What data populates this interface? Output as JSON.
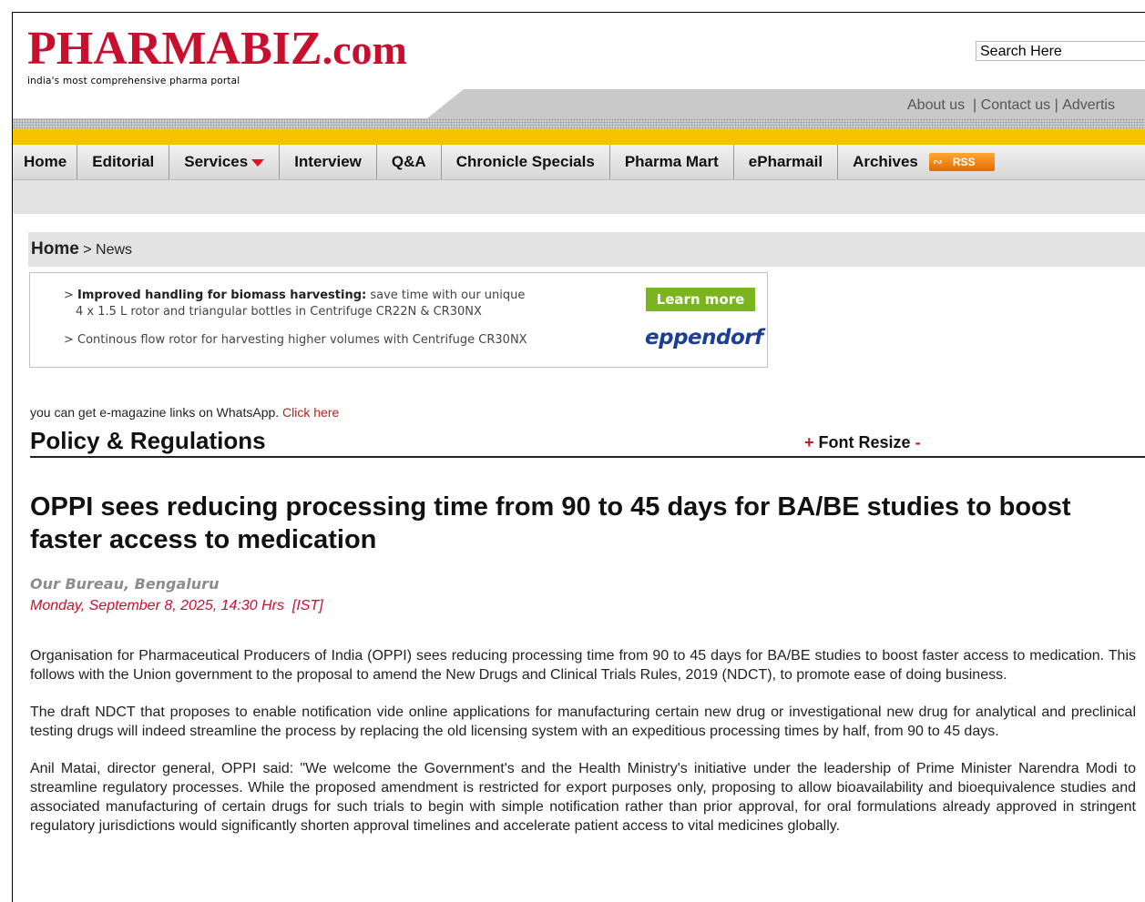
{
  "header": {
    "logo_main": "PHARMABIZ",
    "logo_dotcom": ".com",
    "tagline": "india's most comprehensive pharma portal",
    "search_placeholder": "Search Here",
    "top_links": [
      "About us",
      "Contact us",
      "Advertis"
    ]
  },
  "nav": {
    "items": [
      "Home",
      "Editorial",
      "Services",
      "Interview",
      "Q&A",
      "Chronicle Specials",
      "Pharma Mart",
      "ePharmail",
      "Archives"
    ],
    "rss_label": "RSS"
  },
  "breadcrumb": {
    "home": "Home",
    "separator": ">",
    "current": "News"
  },
  "ad": {
    "line1_bold": "Improved handling for biomass harvesting:",
    "line1_rest": "save time with our unique",
    "line2": "4 x 1.5 L rotor and triangular bottles in Centrifuge CR22N & CR30NX",
    "line3": "> Continous flow rotor for harvesting higher volumes with Centrifuge CR30NX",
    "cta": "Learn more",
    "brand": "eppendorf"
  },
  "whatsapp": {
    "text": "you can get e-magazine links on WhatsApp.",
    "link": "Click here"
  },
  "section": {
    "title": "Policy & Regulations",
    "font_resize": "Font Resize",
    "plus": "+",
    "minus": "-"
  },
  "article": {
    "headline": "OPPI sees reducing processing time from 90 to 45 days for BA/BE studies to boost faster access to medication",
    "byline": "Our Bureau, Bengaluru",
    "dateline": "Monday, September 8, 2025, 14:30 Hrs  [IST]",
    "paragraphs": [
      "Organisation for Pharmaceutical Producers of India (OPPI) sees reducing processing time  from 90 to 45 days for BA/BE studies to boost faster access to medication. This follows with the Union government to the proposal to amend the New Drugs and Clinical Trials Rules, 2019 (NDCT), to promote ease of doing business.",
      "The draft NDCT that proposes to enable notification vide online applications for manufacturing certain new drug or investigational new drug for analytical and preclinical testing drugs will indeed streamline the process by replacing the old licensing system with an expeditious processing times by half, from 90 to 45 days.",
      "Anil Matai, director general, OPPI said: \"We welcome the Government's and the Health Ministry's initiative under the leadership of Prime Minister Narendra Modi to streamline regulatory processes. While the proposed amendment is restricted for export purposes only, proposing to allow bioavailability and bioequivalence studies and associated manufacturing of certain drugs for such trials to begin with simple notification rather than prior approval, for oral formulations already approved in stringent regulatory jurisdictions would significantly shorten approval timelines and accelerate patient access to vital medicines globally."
    ]
  },
  "colors": {
    "brand_red": "#c8102e",
    "yellow_bar": "#f5c300",
    "link_red": "#b22222",
    "rss_orange": "#f08a00"
  }
}
